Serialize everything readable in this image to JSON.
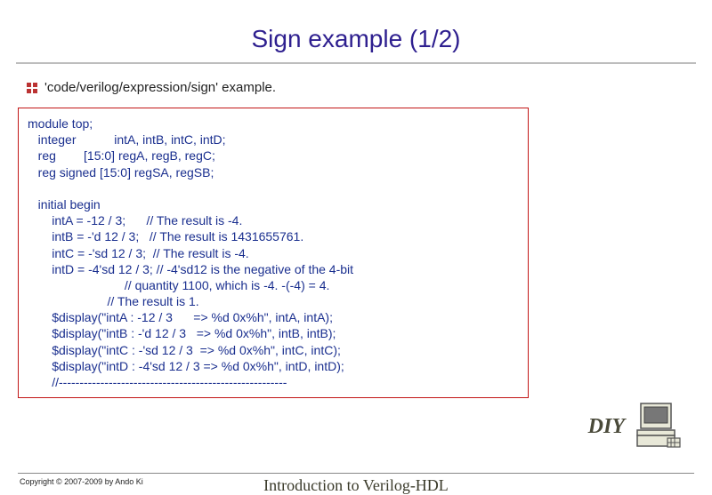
{
  "title": "Sign example (1/2)",
  "bullet": "'code/verilog/expression/sign' example.",
  "code": "module top;\n   integer           intA, intB, intC, intD;\n   reg        [15:0] regA, regB, regC;\n   reg signed [15:0] regSA, regSB;\n\n   initial begin\n       intA = -12 / 3;      // The result is -4.\n       intB = -'d 12 / 3;   // The result is 1431655761.\n       intC = -'sd 12 / 3;  // The result is -4.\n       intD = -4'sd 12 / 3; // -4'sd12 is the negative of the 4-bit\n                            // quantity 1100, which is -4. -(-4) = 4.\n                       // The result is 1.\n       $display(\"intA : -12 / 3      => %d 0x%h\", intA, intA);\n       $display(\"intB : -'d 12 / 3   => %d 0x%h\", intB, intB);\n       $display(\"intC : -'sd 12 / 3  => %d 0x%h\", intC, intC);\n       $display(\"intD : -4'sd 12 / 3 => %d 0x%h\", intD, intD);\n       //-------------------------------------------------------",
  "diy": "DIY",
  "copyright": "Copyright © 2007-2009 by Ando Ki",
  "footerTitle": "Introduction to Verilog-HDL"
}
